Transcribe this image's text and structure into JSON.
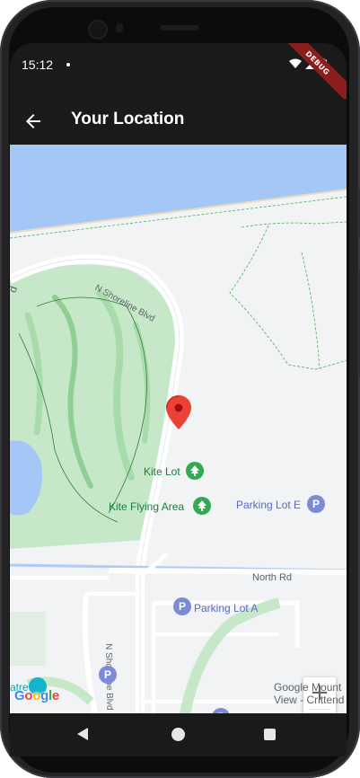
{
  "status_bar": {
    "time": "15:12"
  },
  "debug_banner": "DEBUG",
  "app_bar": {
    "title": "Your Location",
    "back_icon": "arrow-back-icon"
  },
  "map": {
    "labels": {
      "n_shoreline_blvd_top": "N Shoreline Blvd",
      "n_shoreline_blvd_bottom": "N Shoreline Blvd",
      "north_rd": "North Rd",
      "kite_lot": "Kite Lot",
      "kite_flying_area": "Kite Flying Area",
      "parking_lot_e": "Parking Lot E",
      "parking_lot_a": "Parking Lot A",
      "theatre_partial": "atre",
      "partial_d": "d"
    },
    "parking_glyph": "P",
    "marker_icon": "map-pin-icon",
    "zoom": {
      "in": "+",
      "out": "−"
    },
    "google_logo": [
      "G",
      "o",
      "o",
      "g",
      "l",
      "e"
    ],
    "attribution": "Google Mount\nView - Crittend",
    "colors": {
      "water": "#a4c7f5",
      "land": "#f1f3f4",
      "park": "#c6e8c9",
      "road": "#ffffff",
      "marker": "#ea4335",
      "poi_green": "#34a853",
      "poi_parking": "#7b8bd6"
    }
  },
  "nav_bar": {
    "back_icon": "nav-back-icon",
    "home_icon": "nav-home-icon",
    "recents_icon": "nav-recents-icon"
  }
}
